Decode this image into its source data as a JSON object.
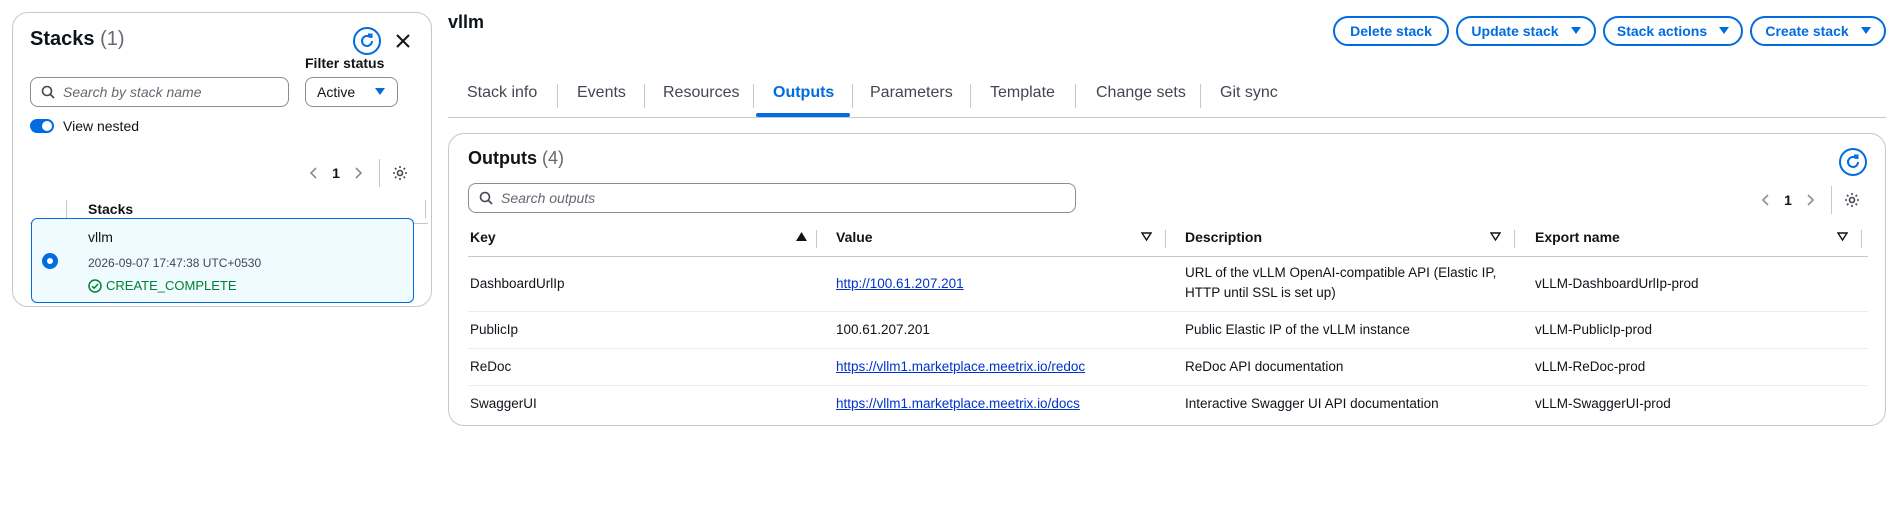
{
  "left_panel": {
    "title": "Stacks",
    "count": "(1)",
    "filter_label": "Filter status",
    "search_placeholder": "Search by stack name",
    "filter_value": "Active",
    "toggle_label": "View nested",
    "page": "1",
    "column_header": "Stacks",
    "stack": {
      "name": "vllm",
      "date": "2026-09-07 17:47:38 UTC+0530",
      "status": "CREATE_COMPLETE"
    }
  },
  "header": {
    "title": "vllm",
    "buttons": {
      "delete": "Delete stack",
      "update": "Update stack",
      "actions": "Stack actions",
      "create": "Create stack"
    }
  },
  "tabs": [
    "Stack info",
    "Events",
    "Resources",
    "Outputs",
    "Parameters",
    "Template",
    "Change sets",
    "Git sync"
  ],
  "outputs": {
    "title": "Outputs",
    "count": "(4)",
    "search_placeholder": "Search outputs",
    "page": "1",
    "columns": [
      "Key",
      "Value",
      "Description",
      "Export name"
    ],
    "rows": [
      {
        "key": "DashboardUrlIp",
        "value": "http://100.61.207.201",
        "value_is_link": true,
        "description": "URL of the vLLM OpenAI-compatible API (Elastic IP, HTTP until SSL is set up)",
        "export": "vLLM-DashboardUrlIp-prod"
      },
      {
        "key": "PublicIp",
        "value": "100.61.207.201",
        "value_is_link": false,
        "description": "Public Elastic IP of the vLLM instance",
        "export": "vLLM-PublicIp-prod"
      },
      {
        "key": "ReDoc",
        "value": "https://vllm1.marketplace.meetrix.io/redoc",
        "value_is_link": true,
        "description": "ReDoc API documentation",
        "export": "vLLM-ReDoc-prod"
      },
      {
        "key": "SwaggerUI",
        "value": "https://vllm1.marketplace.meetrix.io/docs",
        "value_is_link": true,
        "description": "Interactive Swagger UI API documentation",
        "export": "vLLM-SwaggerUI-prod"
      }
    ]
  },
  "colors": {
    "accent": "#006ce0",
    "success": "#00802f",
    "link": "#0033cc"
  }
}
